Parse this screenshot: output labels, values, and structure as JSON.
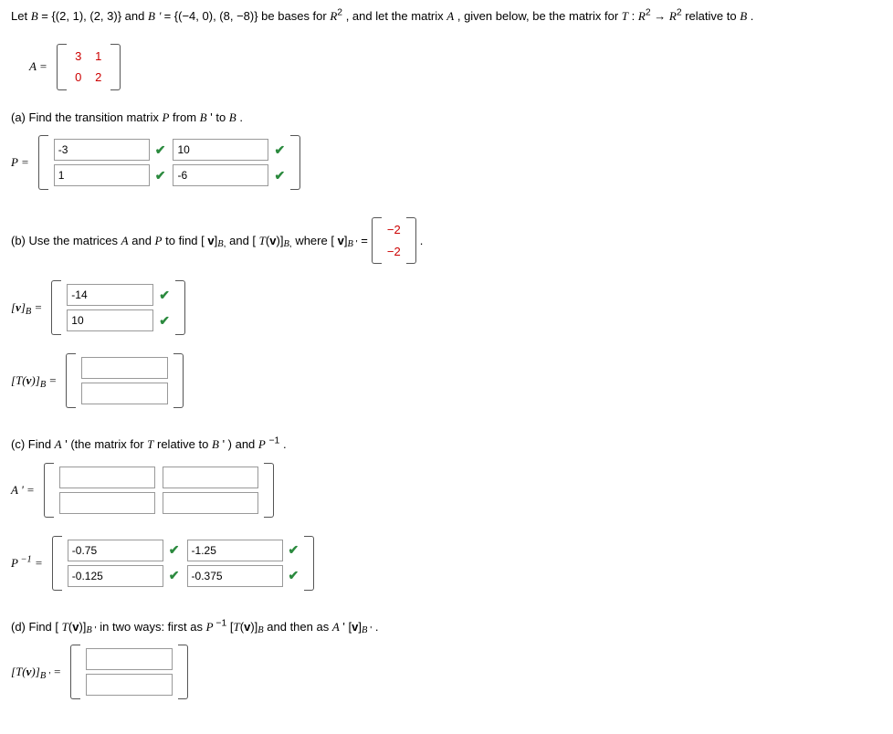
{
  "intro": {
    "pre": "Let ",
    "B": "B",
    "eq1": " = {(2, 1), (2, 3)} and ",
    "Bp": "B",
    "prime": " ' ",
    "eq2": "= {(−4, 0), (8, −8)} be bases for ",
    "R2a": "R",
    "sup2": "2",
    "mid": ", and let the matrix ",
    "A": "A",
    "post": ", given below, be the matrix for ",
    "T": "T",
    "colon": ": ",
    "R2b": "R",
    "arrow": " → ",
    "R2c": "R",
    "rel": " relative to ",
    "Bend": "B",
    "period": "."
  },
  "matrixA": {
    "label": "A =",
    "r1c1": "3",
    "r1c2": "1",
    "r2c1": "0",
    "r2c2": "2"
  },
  "partA": {
    "prompt": "(a) Find the transition matrix ",
    "P": "P",
    "from": " from ",
    "Bp": "B",
    "ptext": " ' to ",
    "B": "B",
    "end": ".",
    "label": "P =",
    "v11": "-3",
    "v12": "10",
    "v21": "1",
    "v22": "-6"
  },
  "partB": {
    "prompt_pre": "(b) Use the matrices ",
    "A": "A",
    "and": " and ",
    "P": "P",
    "tofind": " to find [",
    "v1": "v",
    "sub_B": "B",
    "and2": " and [",
    "T": "T",
    "v2": "v",
    "close": ")]",
    "where": " where [",
    "v3": "v",
    "eq": " = ",
    "small_r1": "−2",
    "small_r2": "−2",
    "label1": "[v]",
    "subB1": "B",
    "eq1": " =",
    "vB_r1": "-14",
    "vB_r2": "10",
    "label2": "[T(v)]",
    "subB2": "B",
    "eq2": " ="
  },
  "partC": {
    "prompt_pre": "(c) Find ",
    "Ap": "A",
    "prime": " ' ",
    "paren": "(the matrix for ",
    "T": "T",
    "rel": " relative to ",
    "Bp": "B",
    "prime2": " ' ",
    "close": ") and ",
    "P": "P",
    "neg1": " −1",
    "end": " .",
    "labelA": "A ' =",
    "labelP": "P",
    "inv_sup": " −1",
    "eqP": " =",
    "p11": "-0.75",
    "p12": "-1.25",
    "p21": "-0.125",
    "p22": "-0.375"
  },
  "partD": {
    "prompt_pre": "(d) Find [",
    "T": "T",
    "v": "v",
    "close": ")]",
    "subBp": "B",
    "in": " in two ways: first as ",
    "P": "P",
    "neg1": " −1",
    "bracket1": "[",
    "T2": "T",
    "v2": "v",
    "close2": ")]",
    "subB": "B",
    "then": " and then as ",
    "Ap": "A",
    "prime": " ' ",
    "bracket2": "[",
    "v3": "v",
    "close3": "]",
    "subBp2": "B",
    "prime2": " '",
    "end": ".",
    "label": "[T(v)]",
    "sub": "B",
    "eqL": " ="
  },
  "placeholders": {
    "sp": ""
  },
  "ops": {
    "comma": ",",
    "open": "(",
    "close": ")",
    "sub_prime": " '"
  }
}
